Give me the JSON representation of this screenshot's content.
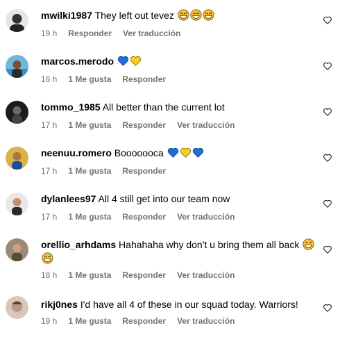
{
  "comments": [
    {
      "user": "mwilki1987",
      "text": "They left out tevez",
      "emojis": [
        "grin-sweat-icon",
        "grin-sweat-icon",
        "grin-sweat-icon"
      ],
      "time": "19 h",
      "likes": "",
      "reply": "Responder",
      "translate": "Ver traducción",
      "avatar_color": "#2a2a2a"
    },
    {
      "user": "marcos.merodo",
      "text": "",
      "emojis": [
        "blue-heart-icon",
        "yellow-heart-icon"
      ],
      "time": "16 h",
      "likes": "1 Me gusta",
      "reply": "Responder",
      "translate": "",
      "avatar_color": "#3a8fc9"
    },
    {
      "user": "tommo_1985",
      "text": "All better than the current lot",
      "emojis": [],
      "time": "17 h",
      "likes": "1 Me gusta",
      "reply": "Responder",
      "translate": "Ver traducción",
      "avatar_color": "#1c1c1c"
    },
    {
      "user": "neenuu.romero",
      "text": "Booooooca",
      "emojis": [
        "blue-heart-icon",
        "yellow-heart-icon",
        "blue-heart-icon"
      ],
      "time": "17 h",
      "likes": "1 Me gusta",
      "reply": "Responder",
      "translate": "",
      "avatar_color": "#d9b24a"
    },
    {
      "user": "dylanlees97",
      "text": "All 4 still get into our team now",
      "emojis": [],
      "time": "17 h",
      "likes": "1 Me gusta",
      "reply": "Responder",
      "translate": "Ver traducción",
      "avatar_color": "#c9c9c9"
    },
    {
      "user": "orellio_arhdams",
      "text": "Hahahaha why don't u bring them all back",
      "emojis": [
        "grin-sweat-icon",
        "grin-sweat-icon"
      ],
      "time": "18 h",
      "likes": "1 Me gusta",
      "reply": "Responder",
      "translate": "Ver traducción",
      "avatar_color": "#8a7a6a"
    },
    {
      "user": "rikj0nes",
      "text": "I'd have all 4 of these in our squad today. Warriors!",
      "emojis": [],
      "time": "19 h",
      "likes": "1 Me gusta",
      "reply": "Responder",
      "translate": "Ver traducción",
      "avatar_color": "#b59a8a"
    }
  ],
  "colors": {
    "meta_text": "#737373",
    "blue_heart": "#1d6fe0",
    "yellow_heart": "#f5d21e",
    "emoji_face": "#f7c335"
  }
}
